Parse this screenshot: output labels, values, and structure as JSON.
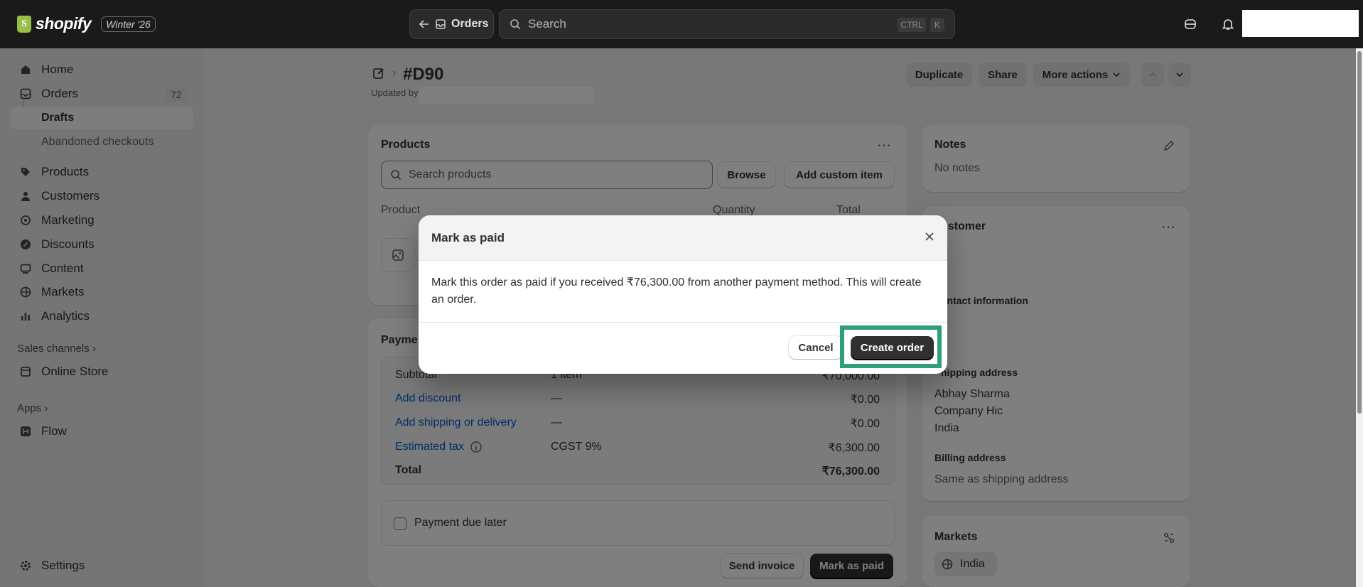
{
  "brand": {
    "name": "shopify",
    "edition": "Winter '26"
  },
  "topbar": {
    "back_label": "Orders",
    "search_placeholder": "Search",
    "shortcut_ctrl": "CTRL",
    "shortcut_key": "K"
  },
  "sidebar": {
    "items": [
      {
        "label": "Home"
      },
      {
        "label": "Orders",
        "badge": "72"
      },
      {
        "label": "Drafts"
      },
      {
        "label": "Abandoned checkouts"
      },
      {
        "label": "Products"
      },
      {
        "label": "Customers"
      },
      {
        "label": "Marketing"
      },
      {
        "label": "Discounts"
      },
      {
        "label": "Content"
      },
      {
        "label": "Markets"
      },
      {
        "label": "Analytics"
      }
    ],
    "sales_channels": "Sales channels",
    "online_store": "Online Store",
    "apps": "Apps",
    "flow": "Flow",
    "settings": "Settings"
  },
  "page": {
    "title": "#D90",
    "updated_by": "Updated by",
    "duplicate": "Duplicate",
    "share": "Share",
    "more_actions": "More actions"
  },
  "products": {
    "title": "Products",
    "search_placeholder": "Search products",
    "browse": "Browse",
    "add_custom": "Add custom item",
    "col_product": "Product",
    "col_quantity": "Quantity",
    "col_total": "Total"
  },
  "payment": {
    "title": "Payme",
    "rows": [
      {
        "label": "Subtotal",
        "middle": "1 item",
        "amount": "₹70,000.00"
      },
      {
        "label": "Add discount",
        "middle": "—",
        "amount": "₹0.00"
      },
      {
        "label": "Add shipping or delivery",
        "middle": "—",
        "amount": "₹0.00"
      },
      {
        "label": "Estimated tax",
        "middle": "CGST 9%",
        "amount": "₹6,300.00"
      },
      {
        "label": "Total",
        "middle": "",
        "amount": "₹76,300.00"
      }
    ],
    "due_later": "Payment due later",
    "send_invoice": "Send invoice",
    "mark_paid": "Mark as paid"
  },
  "notes": {
    "title": "Notes",
    "value": "No notes"
  },
  "customer": {
    "title": "ustomer",
    "contact": "ontact information",
    "shipping_title": "hipping address",
    "shipping_lines": [
      "Abhay Sharma",
      "Company Hic",
      "India"
    ],
    "billing_title": "Billing address",
    "billing_value": "Same as shipping address"
  },
  "markets": {
    "title": "Markets",
    "chip": "India"
  },
  "modal": {
    "title": "Mark as paid",
    "body": "Mark this order as paid if you received ₹76,300.00 from another payment method. This will create an order.",
    "cancel": "Cancel",
    "confirm": "Create order"
  },
  "colors": {
    "highlight": "#2e9e7d",
    "link": "#005bd3",
    "topbar": "#1a1a1a"
  }
}
